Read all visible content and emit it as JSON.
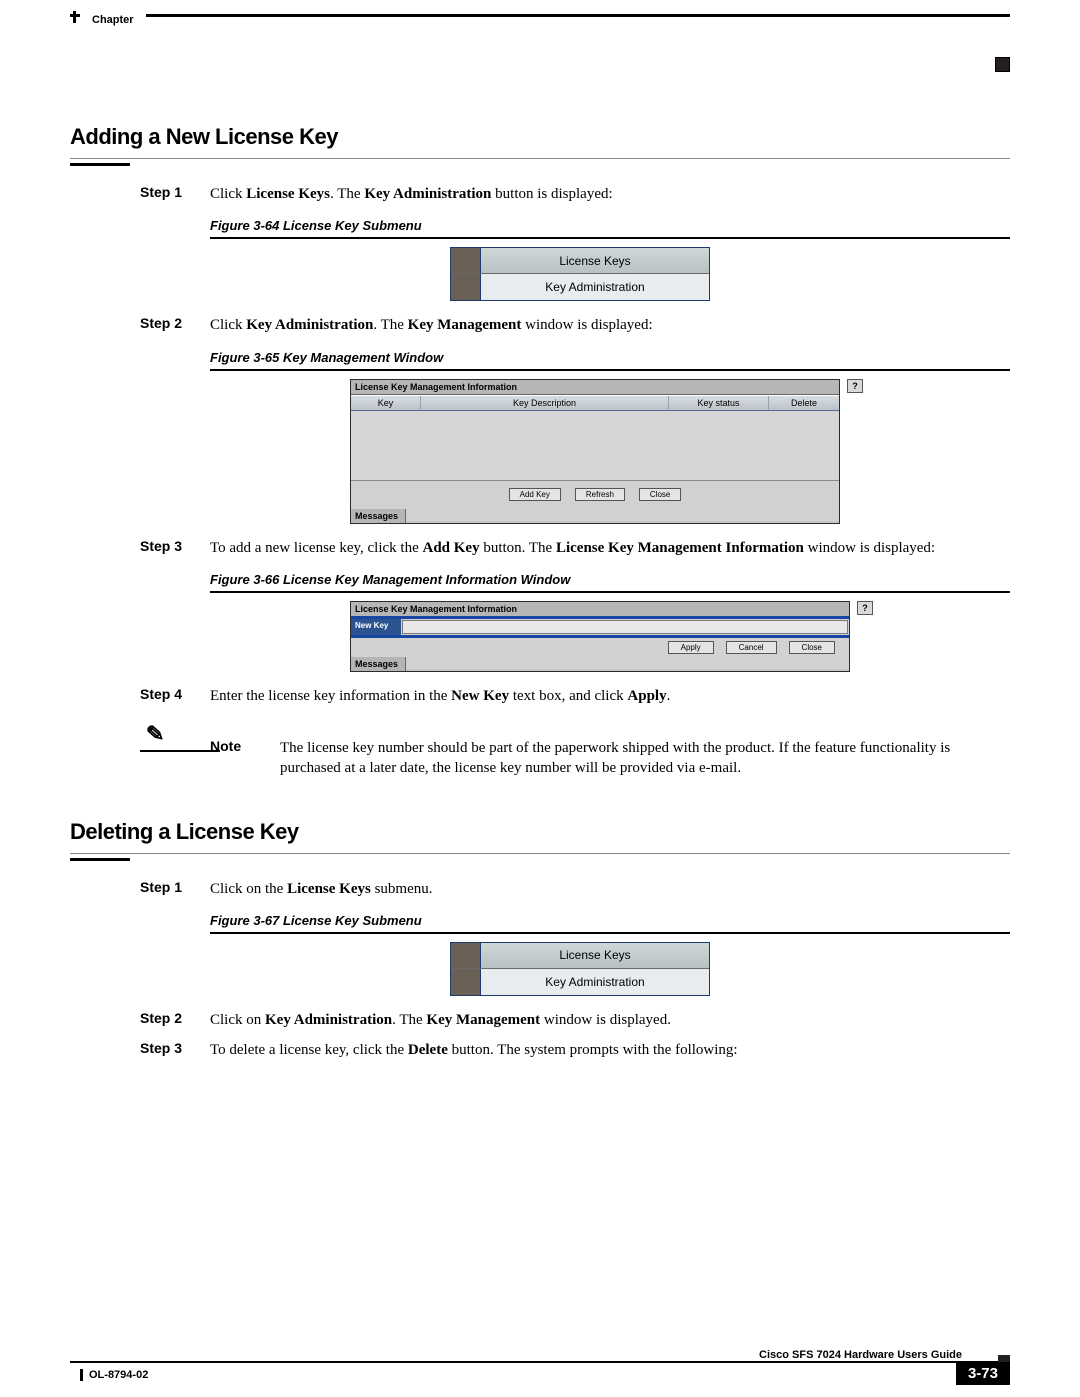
{
  "header": {
    "chapter": "Chapter"
  },
  "section1": {
    "title": "Adding a New License Key",
    "steps": {
      "s1": {
        "label": "Step 1",
        "pre": "Click ",
        "b1": "License Keys",
        "mid": ". The ",
        "b2": "Key Administration",
        "post": " button is displayed:"
      },
      "s2": {
        "label": "Step 2",
        "pre": "Click ",
        "b1": "Key Administration",
        "mid": ". The ",
        "b2": "Key Management",
        "post": " window is displayed:"
      },
      "s3": {
        "label": "Step 3",
        "pre": "To add a new license key, click the ",
        "b1": "Add Key",
        "mid": " button. The ",
        "b2": "License Key Management Information",
        "post": " window is displayed:"
      },
      "s4": {
        "label": "Step 4",
        "pre": "Enter the license key information in the ",
        "b1": "New Key",
        "mid": " text box, and click ",
        "b2": "Apply",
        "post": "."
      }
    },
    "figures": {
      "f64": {
        "caption": "Figure 3-64   License Key Submenu",
        "menu1": "License Keys",
        "menu2": "Key Administration"
      },
      "f65": {
        "caption": "Figure 3-65   Key Management Window",
        "title": "License Key Management Information",
        "help": "?",
        "col1": "Key",
        "col2": "Key Description",
        "col3": "Key status",
        "col4": "Delete",
        "btn1": "Add Key",
        "btn2": "Refresh",
        "btn3": "Close",
        "msg": "Messages"
      },
      "f66": {
        "caption": "Figure 3-66   License Key Management Information Window",
        "title": "License Key Management Information",
        "help": "?",
        "rowlabel": "New Key",
        "btn1": "Apply",
        "btn2": "Cancel",
        "btn3": "Close",
        "msg": "Messages"
      }
    },
    "note": {
      "label": "Note",
      "text": "The license key number should be part of the paperwork shipped with the product. If the feature functionality is purchased at a later date, the license key number will be provided via e-mail."
    }
  },
  "section2": {
    "title": "Deleting a License Key",
    "steps": {
      "s1": {
        "label": "Step 1",
        "pre": "Click on the ",
        "b1": "License Keys",
        "post": " submenu."
      },
      "s2": {
        "label": "Step 2",
        "pre": "Click on ",
        "b1": "Key Administration",
        "mid": ". The ",
        "b2": "Key Management",
        "post": " window is displayed."
      },
      "s3": {
        "label": "Step 3",
        "pre": "To delete a license key, click the ",
        "b1": "Delete",
        "post": " button. The system prompts with the following:"
      }
    },
    "figures": {
      "f67": {
        "caption": "Figure 3-67   License Key Submenu",
        "menu1": "License Keys",
        "menu2": "Key Administration"
      }
    }
  },
  "footer": {
    "guide": "Cisco SFS 7024 Hardware Users Guide",
    "docnum": "OL-8794-02",
    "page": "3-73"
  }
}
